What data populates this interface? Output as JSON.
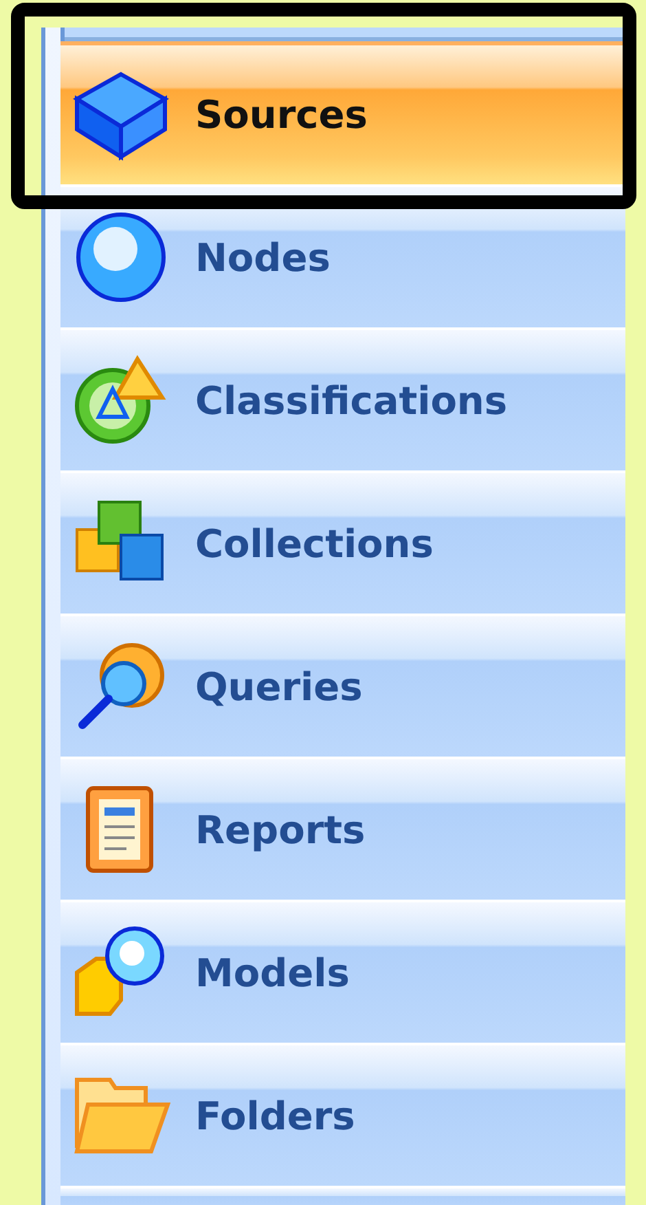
{
  "navigation_pane": {
    "items": [
      {
        "label": "Sources",
        "selected": true
      },
      {
        "label": "Nodes",
        "selected": false
      },
      {
        "label": "Classifications",
        "selected": false
      },
      {
        "label": "Collections",
        "selected": false
      },
      {
        "label": "Queries",
        "selected": false
      },
      {
        "label": "Reports",
        "selected": false
      },
      {
        "label": "Models",
        "selected": false
      },
      {
        "label": "Folders",
        "selected": false
      }
    ]
  }
}
